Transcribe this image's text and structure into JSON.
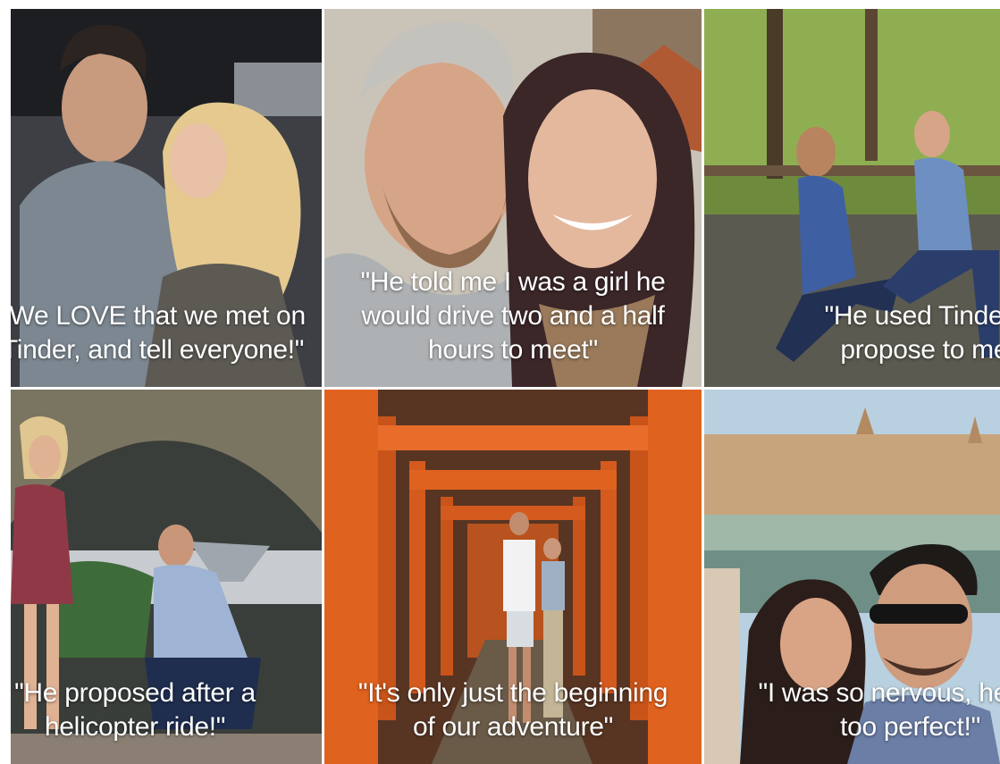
{
  "tiles": [
    {
      "id": "couple-1",
      "line1": "\"We LOVE that we met on",
      "line2": "Tinder, and tell everyone!\""
    },
    {
      "id": "couple-2",
      "line1": "\"He told me I was a girl he",
      "line2": "would drive two and a half",
      "line3": "hours to meet\""
    },
    {
      "id": "couple-3",
      "line1": "\"He used Tinder to",
      "line2": "propose to me!\""
    },
    {
      "id": "couple-4",
      "line1": "\"He proposed after a",
      "line2": "helicopter ride!\""
    },
    {
      "id": "couple-5",
      "line1": "\"It's only just the beginning",
      "line2": "of our adventure\""
    },
    {
      "id": "couple-6",
      "line1": "\"I was so nervous, he was",
      "line2": "too perfect!\""
    }
  ],
  "colors": {
    "torii_orange": "#e0621f",
    "caption_text": "#ffffff"
  }
}
